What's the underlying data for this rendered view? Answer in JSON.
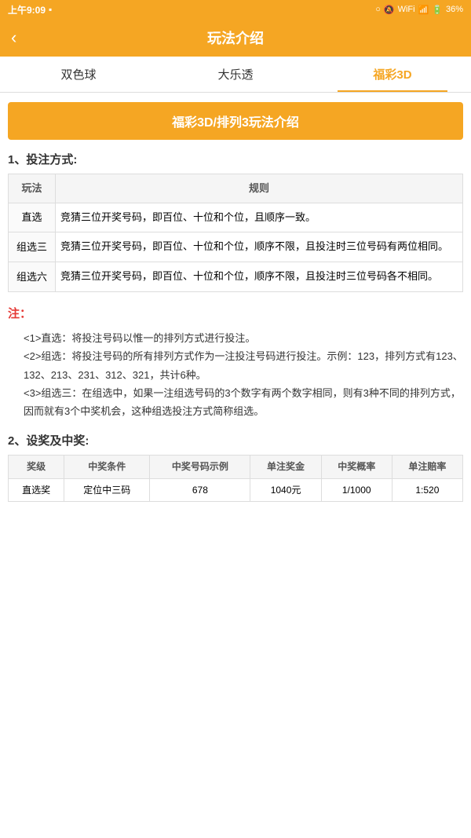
{
  "statusBar": {
    "time": "上午9:09",
    "battery": "36%"
  },
  "header": {
    "back": "‹",
    "title": "玩法介绍"
  },
  "tabs": [
    {
      "id": "tab1",
      "label": "双色球",
      "active": false
    },
    {
      "id": "tab2",
      "label": "大乐透",
      "active": false
    },
    {
      "id": "tab3",
      "label": "福彩3D",
      "active": true
    }
  ],
  "banner": {
    "text": "福彩3D/排列3玩法介绍"
  },
  "section1": {
    "title": "1、投注方式:",
    "tableHeaders": [
      "玩法",
      "规则"
    ],
    "rows": [
      {
        "name": "直选",
        "rule": "竞猜三位开奖号码，即百位、十位和个位，且顺序一致。"
      },
      {
        "name": "组选三",
        "rule": "竞猜三位开奖号码，即百位、十位和个位，顺序不限，且投注时三位号码有两位相同。"
      },
      {
        "name": "组选六",
        "rule": "竞猜三位开奖号码，即百位、十位和个位，顺序不限，且投注时三位号码各不相同。"
      }
    ]
  },
  "notes": {
    "title": "注：",
    "items": [
      "<1>直选：将投注号码以惟一的排列方式进行投注。",
      "<2>组选：将投注号码的所有排列方式作为一注投注号码进行投注。示例：123，排列方式有123、132、213、231、312、321，共计6种。",
      "<3>组选三：在组选中，如果一注组选号码的3个数字有两个数字相同，则有3种不同的排列方式，因而就有3个中奖机会，这种组选投注方式简称组选。"
    ]
  },
  "section2": {
    "title": "2、设奖及中奖:",
    "prizeHeaders": [
      "奖级",
      "中奖条件",
      "中奖号码示例",
      "单注奖金",
      "中奖概率",
      "单注赔率"
    ],
    "prizeRows": [
      {
        "level": "直选奖",
        "condition": "定位中三码",
        "example": "678",
        "prize": "1040元",
        "probability": "1/1000",
        "ratio": "1:520"
      }
    ]
  }
}
